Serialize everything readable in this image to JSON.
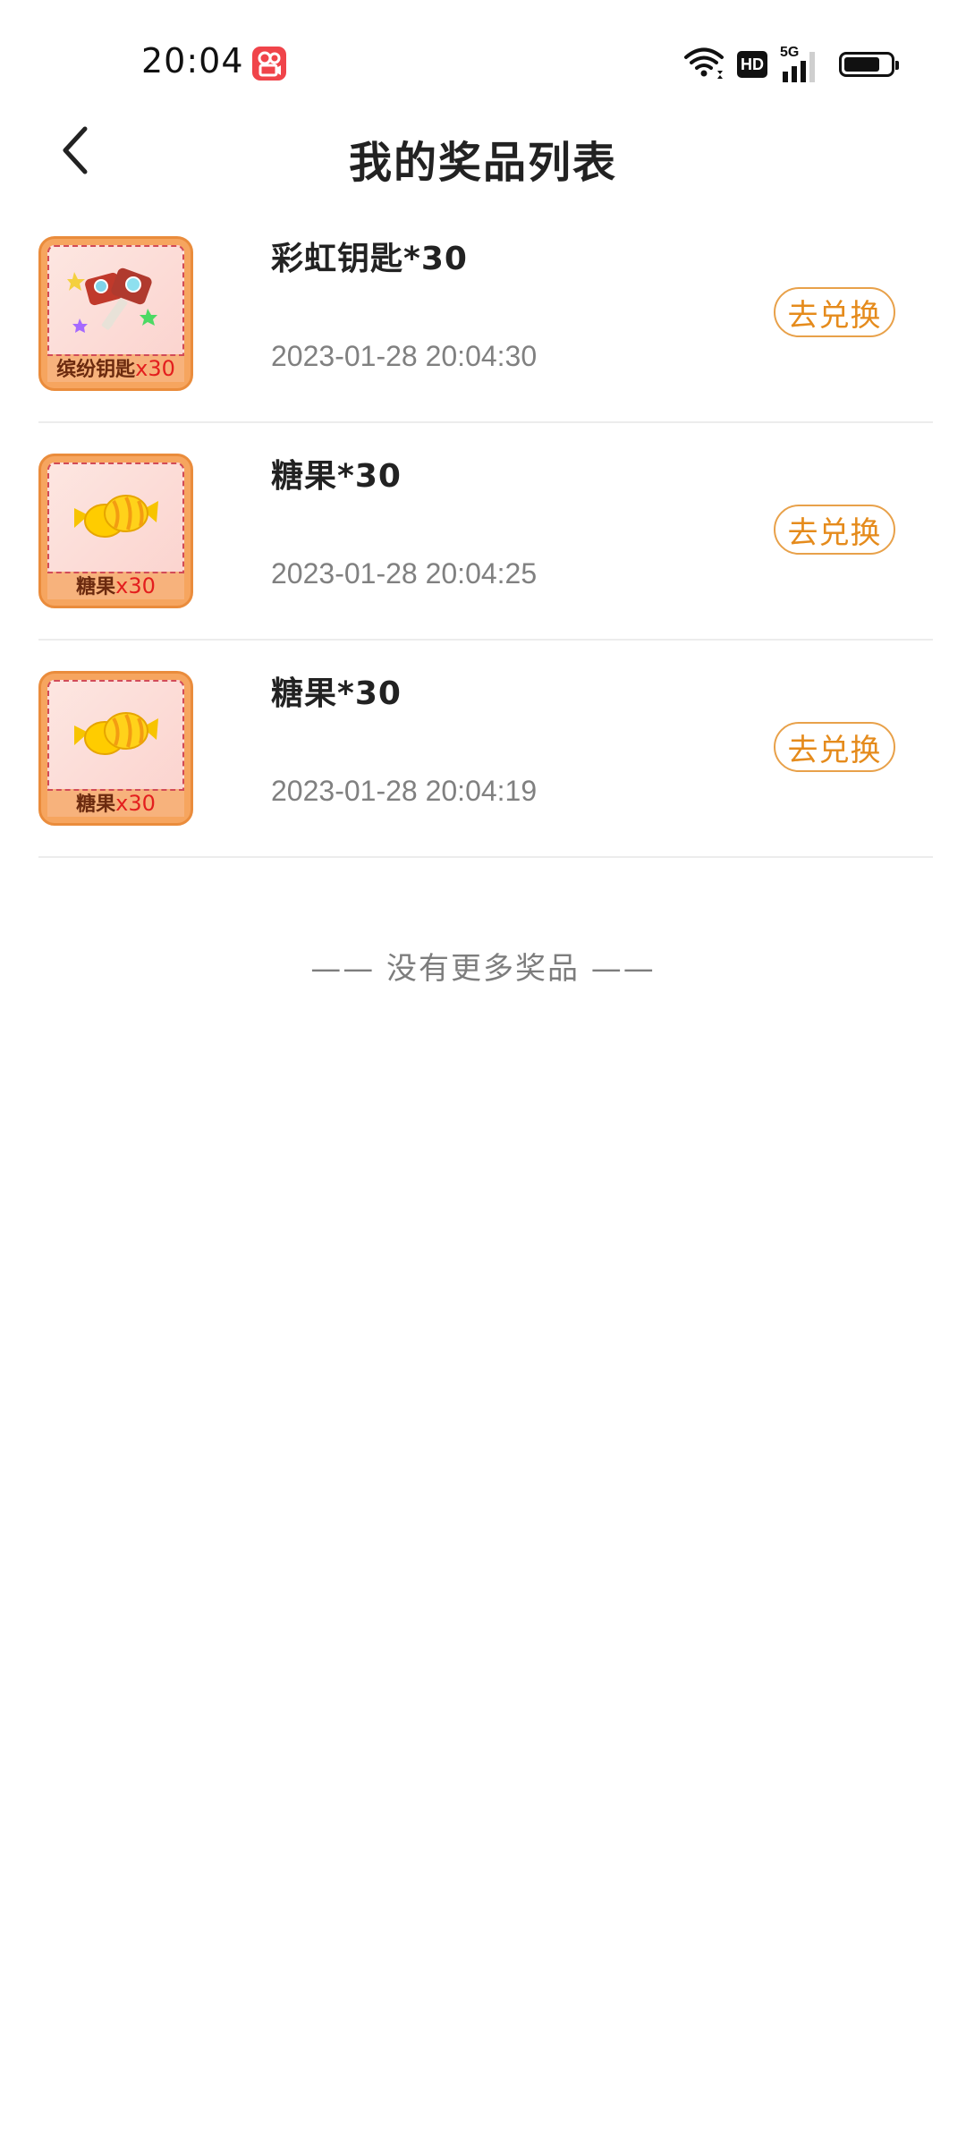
{
  "status_bar": {
    "time": "20:04",
    "app_icon": "kuaishou-app-icon",
    "network_type": "5G",
    "hd_label": "HD",
    "battery_level": 0.75
  },
  "header": {
    "back_icon": "chevron-left-icon",
    "title": "我的奖品列表"
  },
  "prizes": [
    {
      "name": "彩虹钥匙*30",
      "time": "2023-01-28 20:04:30",
      "button": "去兑换",
      "image_caption": "缤纷钥匙",
      "image_qty": "x30",
      "icon": "rainbow-key-icon"
    },
    {
      "name": "糖果*30",
      "time": "2023-01-28 20:04:25",
      "button": "去兑换",
      "image_caption": "糖果",
      "image_qty": "x30",
      "icon": "candy-icon"
    },
    {
      "name": "糖果*30",
      "time": "2023-01-28 20:04:19",
      "button": "去兑换",
      "image_caption": "糖果",
      "image_qty": "x30",
      "icon": "candy-icon"
    }
  ],
  "footer": {
    "no_more": "—— 没有更多奖品 ——"
  },
  "colors": {
    "accent": "#e58b1c",
    "accent_border": "#e8a14a",
    "divider": "#ececec"
  }
}
